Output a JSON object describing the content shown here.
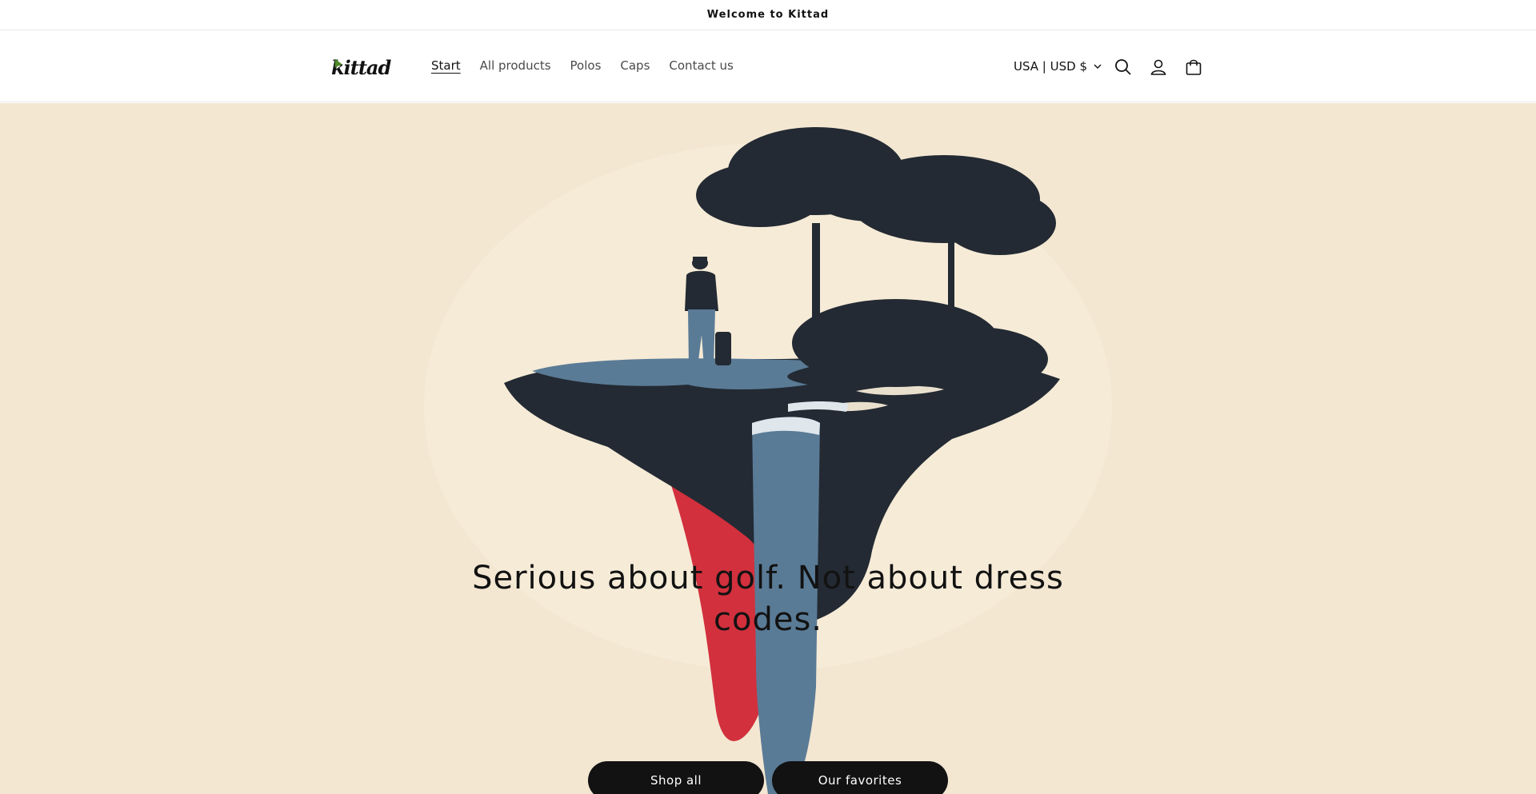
{
  "announcement": {
    "text": "Welcome to Kittad"
  },
  "header": {
    "logo_text": "kittad",
    "nav": [
      {
        "label": "Start",
        "active": true
      },
      {
        "label": "All products",
        "active": false
      },
      {
        "label": "Polos",
        "active": false
      },
      {
        "label": "Caps",
        "active": false
      },
      {
        "label": "Contact us",
        "active": false
      }
    ],
    "currency": "USA | USD $",
    "icons": [
      "search-icon",
      "account-icon",
      "cart-icon",
      "chevron-down-icon"
    ]
  },
  "hero": {
    "heading": "Serious about golf. Not about dress codes.",
    "buttons": [
      {
        "label": "Shop all"
      },
      {
        "label": "Our favorites"
      }
    ],
    "colors": {
      "background": "#f3e7d2",
      "ink": "#232a33",
      "water": "#5a7b96",
      "red": "#d2303d"
    }
  }
}
